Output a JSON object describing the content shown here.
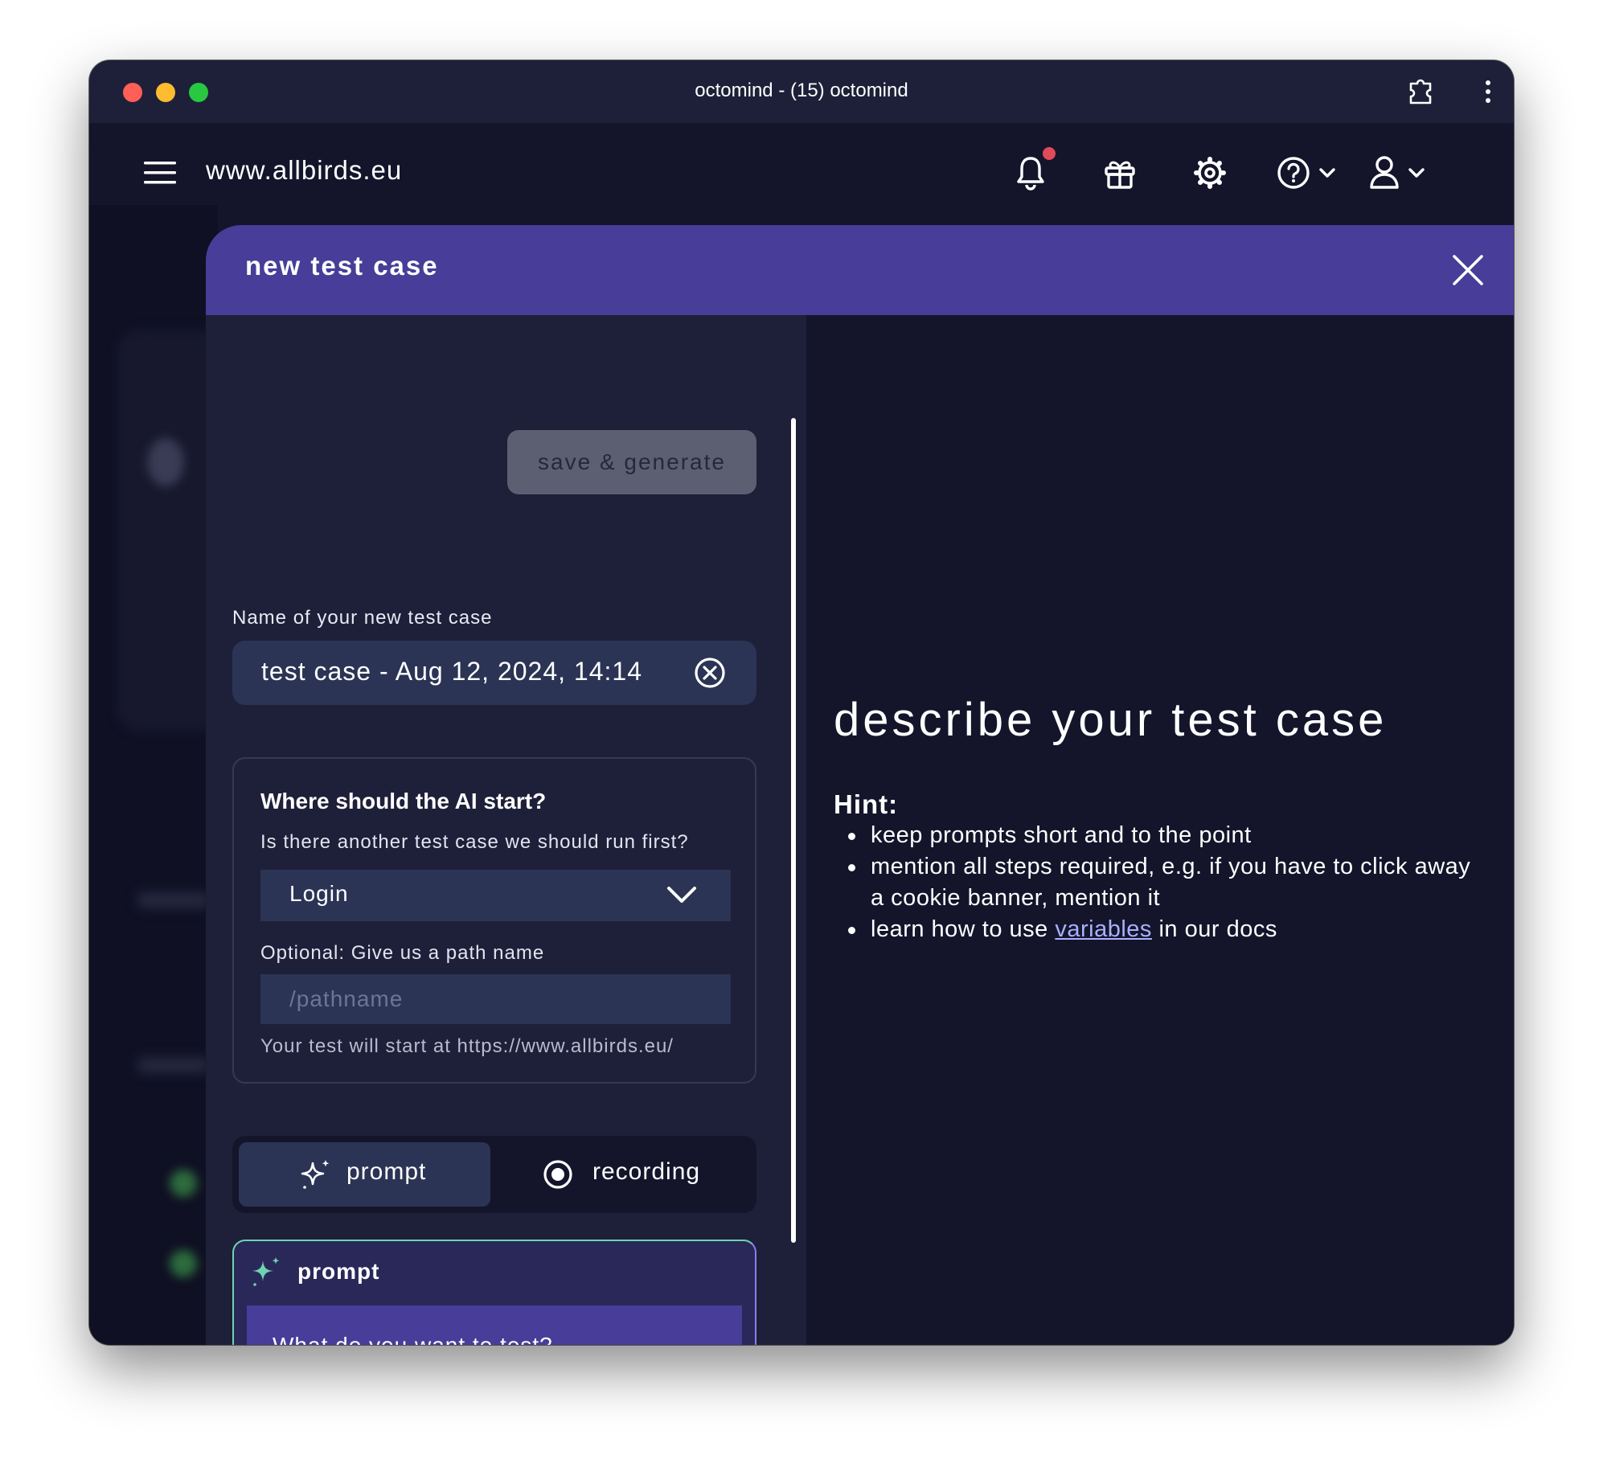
{
  "window": {
    "title": "octomind - (15) octomind"
  },
  "appbar": {
    "domain": "www.allbirds.eu",
    "icons": [
      "menu-icon",
      "bell-icon",
      "gift-icon",
      "gear-icon",
      "help-icon",
      "user-icon"
    ]
  },
  "modal": {
    "title": "new test case",
    "save_label": "save & generate",
    "name_label": "Name of your new test case",
    "name_value": "test case - Aug 12, 2024, 14:14",
    "start": {
      "title": "Where should the AI start?",
      "question": "Is there another test case we should run first?",
      "selected": "Login",
      "path_label": "Optional: Give us a path name",
      "path_placeholder": "/pathname",
      "start_at": "Your test will start at https://www.allbirds.eu/"
    },
    "modes": {
      "prompt_label": "prompt",
      "recording_label": "recording"
    },
    "prompt_card": {
      "title": "prompt",
      "placeholder": "What do you want to test?"
    }
  },
  "right": {
    "heading": "describe your test case",
    "hint_title": "Hint:",
    "hint_1": "keep prompts short and to the point",
    "hint_2": "mention all steps required, e.g. if you have to click away a cookie banner, mention it",
    "hint_3_before": "learn how to use ",
    "hint_3_link": "variables",
    "hint_3_after": " in our docs"
  },
  "colors": {
    "accent": "#483d99",
    "panel": "#1e2039",
    "background": "#14152b",
    "input": "#2b3454",
    "notification": "#e04a5a",
    "prompt_border": "#6dd3b2"
  }
}
